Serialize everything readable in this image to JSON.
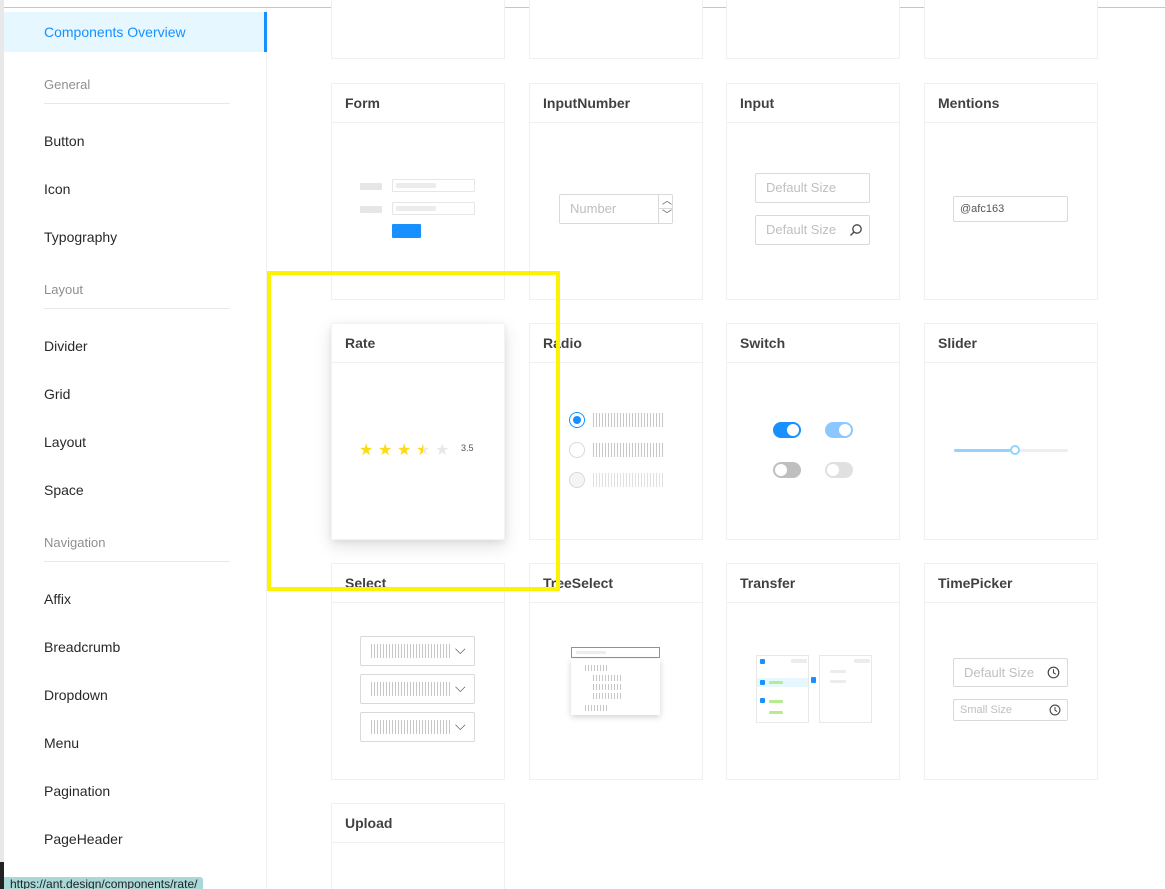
{
  "sidebar": {
    "active_item": "Components Overview",
    "groups": {
      "general": "General",
      "layout": "Layout",
      "navigation": "Navigation"
    },
    "items": {
      "button": "Button",
      "icon": "Icon",
      "typography": "Typography",
      "divider": "Divider",
      "grid": "Grid",
      "layout": "Layout",
      "space": "Space",
      "affix": "Affix",
      "breadcrumb": "Breadcrumb",
      "dropdown": "Dropdown",
      "menu": "Menu",
      "pagination": "Pagination",
      "pageheader": "PageHeader"
    }
  },
  "status_url": "https://ant.design/components/rate/",
  "cards": {
    "form": "Form",
    "inputnumber": "InputNumber",
    "input": "Input",
    "mentions": "Mentions",
    "rate": "Rate",
    "radio": "Radio",
    "switch": "Switch",
    "slider": "Slider",
    "select": "Select",
    "treeselect": "TreeSelect",
    "transfer": "Transfer",
    "timepicker": "TimePicker",
    "upload": "Upload"
  },
  "previews": {
    "inputnumber_placeholder": "Number",
    "input_placeholder_1": "Default Size",
    "input_placeholder_2": "Default Size",
    "mentions_value": "@afc163",
    "rate_value": "3.5",
    "timepicker_placeholder_1": "Default Size",
    "timepicker_placeholder_2": "Small Size"
  },
  "rate": {
    "score": 3.5,
    "max": 5
  },
  "colors": {
    "primary": "#1890ff",
    "highlight": "#fff200",
    "star": "#fadb14"
  }
}
